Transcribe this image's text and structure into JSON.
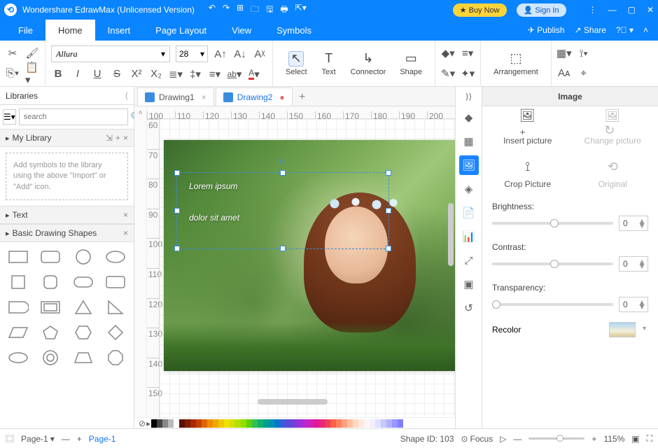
{
  "titlebar": {
    "app": "Wondershare EdrawMax (Unlicensed Version)",
    "buy": "★ Buy Now",
    "signin": "👤 Sign In"
  },
  "menu": {
    "tabs": [
      "File",
      "Home",
      "Insert",
      "Page Layout",
      "View",
      "Symbols"
    ],
    "active": 1,
    "publish": "✈ Publish",
    "share": "↗ Share"
  },
  "ribbon": {
    "font": {
      "name": "Allura",
      "size": "28"
    },
    "tools": {
      "select": "Select",
      "text": "Text",
      "connector": "Connector",
      "shape": "Shape",
      "arrangement": "Arrangement"
    }
  },
  "libraries": {
    "title": "Libraries",
    "search_ph": "search",
    "mylib": "My Library",
    "hint": "Add symbols to the library using the above \"Import\" or \"Add\" icon.",
    "text": "Text",
    "basic": "Basic Drawing Shapes"
  },
  "doctabs": {
    "tabs": [
      {
        "name": "Drawing1",
        "dirty": false
      },
      {
        "name": "Drawing2",
        "dirty": true
      }
    ],
    "active": 1
  },
  "ruler_h": [
    "100",
    "110",
    "120",
    "130",
    "140",
    "150",
    "160",
    "170",
    "180",
    "190",
    "200"
  ],
  "ruler_v": [
    "60",
    "70",
    "80",
    "90",
    "100",
    "110",
    "120",
    "130",
    "140",
    "150"
  ],
  "caption": {
    "line1": "Lorem ipsum",
    "line2": "dolor sit amet"
  },
  "prop": {
    "title": "Image",
    "insert": "Insert picture",
    "change": "Change picture",
    "crop": "Crop Picture",
    "orig": "Original",
    "brightness": "Brightness:",
    "contrast": "Contrast:",
    "transparency": "Transparency:",
    "b_val": "0",
    "c_val": "0",
    "t_val": "0",
    "recolor": "Recolor"
  },
  "status": {
    "page": "Page-1",
    "pagename": "Page-1",
    "shapeid": "Shape ID: 103",
    "focus": "Focus",
    "zoom": "115%"
  },
  "colors": [
    "#000",
    "#444",
    "#888",
    "#bbb",
    "#fff",
    "#5b0f00",
    "#7f1d00",
    "#a52a00",
    "#c44000",
    "#e06600",
    "#f08c00",
    "#f0a800",
    "#f0c800",
    "#f0e000",
    "#d4e000",
    "#b0e000",
    "#8ce000",
    "#60d000",
    "#30c050",
    "#10b070",
    "#00a090",
    "#0090b0",
    "#0078d0",
    "#3a5cd8",
    "#5a48d8",
    "#7a3cd8",
    "#9a30d8",
    "#b828d0",
    "#d020b8",
    "#e01898",
    "#e82878",
    "#f04058",
    "#f86048",
    "#ff8060",
    "#ffa080",
    "#ffc0a0",
    "#ffd8c0",
    "#ffe8e0",
    "#fff4f0",
    "#f0f0ff",
    "#e0e0ff",
    "#c8c8ff",
    "#b0b0ff",
    "#9898ff",
    "#8080ff"
  ]
}
